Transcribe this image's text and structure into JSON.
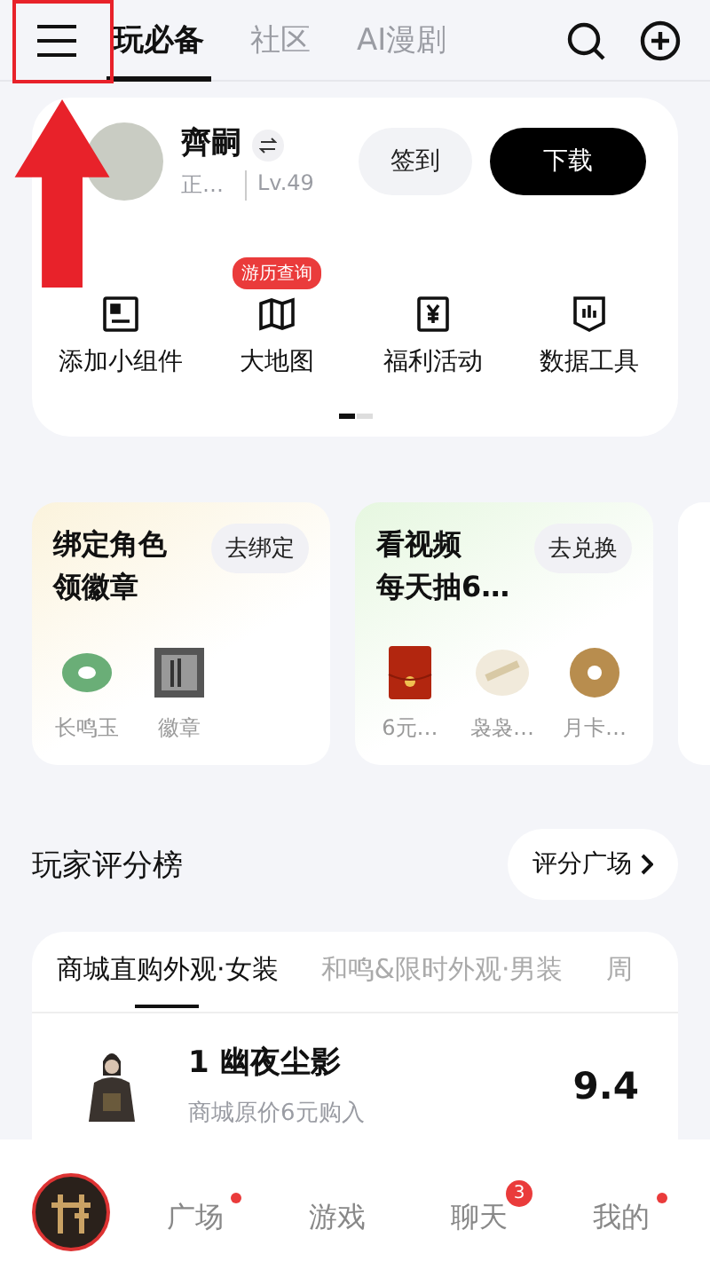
{
  "header": {
    "tabs": [
      {
        "label": "玩必备",
        "selected": true
      },
      {
        "label": "社区",
        "selected": false
      },
      {
        "label": "AI漫剧",
        "selected": false
      }
    ]
  },
  "profile": {
    "name": "齊嗣",
    "server": "正…",
    "level": "Lv.49",
    "checkin": "签到",
    "download": "下载"
  },
  "tools": [
    {
      "kind": "widget",
      "label": "添加小组件"
    },
    {
      "kind": "map",
      "label": "大地图",
      "badge": "游历查询"
    },
    {
      "kind": "welfare",
      "label": "福利活动"
    },
    {
      "kind": "data",
      "label": "数据工具"
    }
  ],
  "pager": [
    {
      "selected": true
    },
    {
      "selected": false
    }
  ],
  "promos": [
    {
      "title": [
        "绑定角色",
        "领徽章"
      ],
      "action": "去绑定",
      "rewards": [
        {
          "kind": "jade",
          "label": "长鸣玉"
        },
        {
          "kind": "emblem",
          "label": "徽章"
        }
      ]
    },
    {
      "title": [
        "看视频",
        "每天抽6…"
      ],
      "action": "去兑换",
      "rewards": [
        {
          "kind": "envelope",
          "label": "6元…"
        },
        {
          "kind": "scroll",
          "label": "袅袅…"
        },
        {
          "kind": "coin",
          "label": "月卡…"
        }
      ]
    }
  ],
  "ranking": {
    "title": "玩家评分榜",
    "more": "评分广场",
    "tabs": [
      {
        "label": "商城直购外观·女装",
        "selected": true
      },
      {
        "label": "和鸣&限时外观·男装",
        "selected": false
      },
      {
        "label": "周",
        "selected": false
      }
    ],
    "items": [
      {
        "rank": "1",
        "name": "幽夜尘影",
        "note": "商城原价6元购入",
        "score": "9.4"
      }
    ]
  },
  "nav": [
    {
      "label": "广场",
      "dot": true
    },
    {
      "label": "游戏",
      "dot": false
    },
    {
      "label": "聊天",
      "count": "3",
      "dot": false
    },
    {
      "label": "我的",
      "dot": true
    }
  ]
}
